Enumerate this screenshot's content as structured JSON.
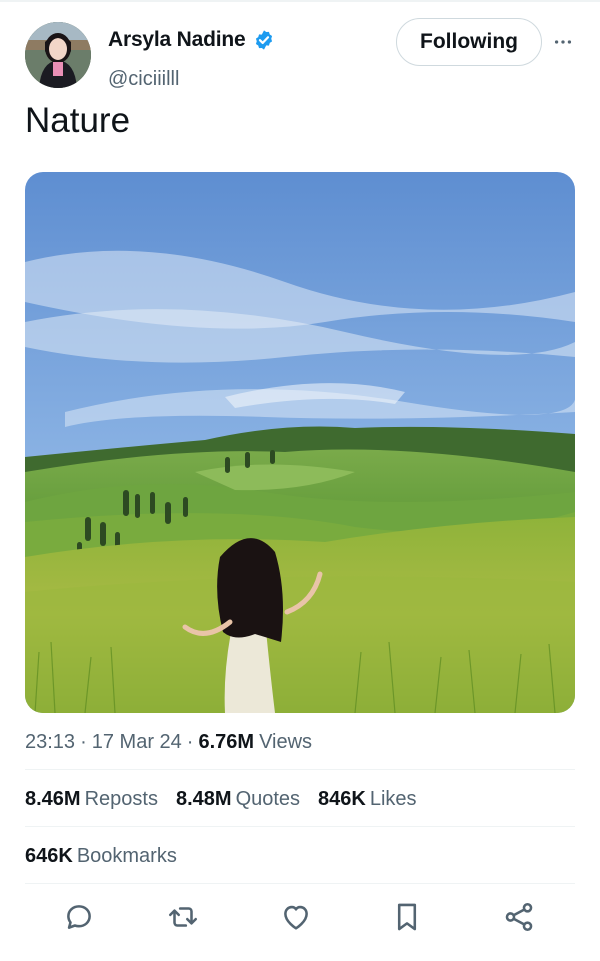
{
  "author": {
    "display_name": "Arsyla Nadine",
    "handle": "@ciciiilll",
    "verified": true
  },
  "follow_button": {
    "label": "Following"
  },
  "tweet": {
    "text": "Nature"
  },
  "meta": {
    "time": "23:13",
    "separator_1": "·",
    "date": "17 Mar 24",
    "separator_2": "·",
    "views_count": "6.76M",
    "views_label": "Views"
  },
  "stats": {
    "reposts": {
      "count": "8.46M",
      "label": "Reposts"
    },
    "quotes": {
      "count": "8.48M",
      "label": "Quotes"
    },
    "likes": {
      "count": "846K",
      "label": "Likes"
    },
    "bookmarks": {
      "count": "646K",
      "label": "Bookmarks"
    }
  },
  "actions": [
    "reply-icon",
    "repost-icon",
    "like-icon",
    "bookmark-icon",
    "share-icon"
  ],
  "colors": {
    "verified_blue": "#1d9bf0",
    "text_primary": "#0f1419",
    "text_secondary": "#536471",
    "action_icon": "#536471"
  }
}
